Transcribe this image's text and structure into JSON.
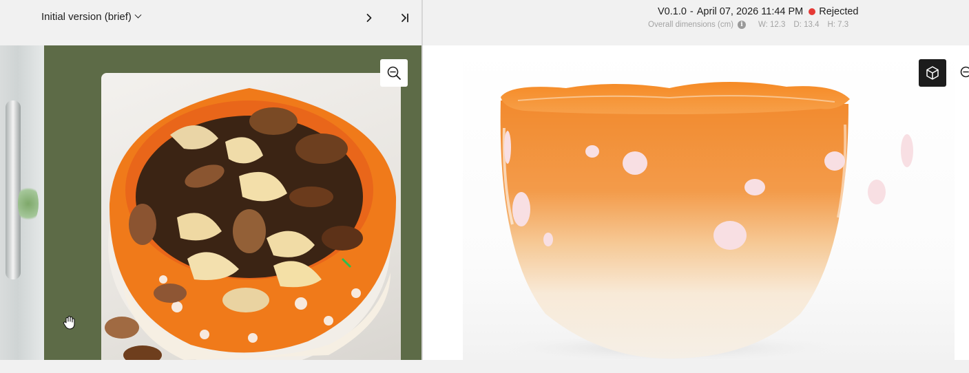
{
  "left_panel": {
    "version_select_label": "Initial version (brief)",
    "next_icon": "chevron-right-icon",
    "last_icon": "skip-to-end-icon",
    "zoom_icon": "zoom-out-icon",
    "cursor_icon": "hand-grab-icon",
    "image_description_icon": "reference-photo"
  },
  "right_panel": {
    "version": "V0.1.0",
    "separator": "-",
    "datetime": "April 07, 2026 11:44 PM",
    "status": "Rejected",
    "status_color": "#e53935",
    "dimensions_label": "Overall dimensions (cm)",
    "dimensions": {
      "width": "W: 12.3",
      "depth": "D: 13.4",
      "height": "H: 7.3"
    },
    "view3d_icon": "cube-icon",
    "zoom_icon": "zoom-out-icon"
  },
  "colors": {
    "frame_green": "#5d6b47",
    "bowl_orange": "#f07a1a",
    "bowl_cream": "#f7efe2",
    "dark_button": "#1c1c1c"
  }
}
